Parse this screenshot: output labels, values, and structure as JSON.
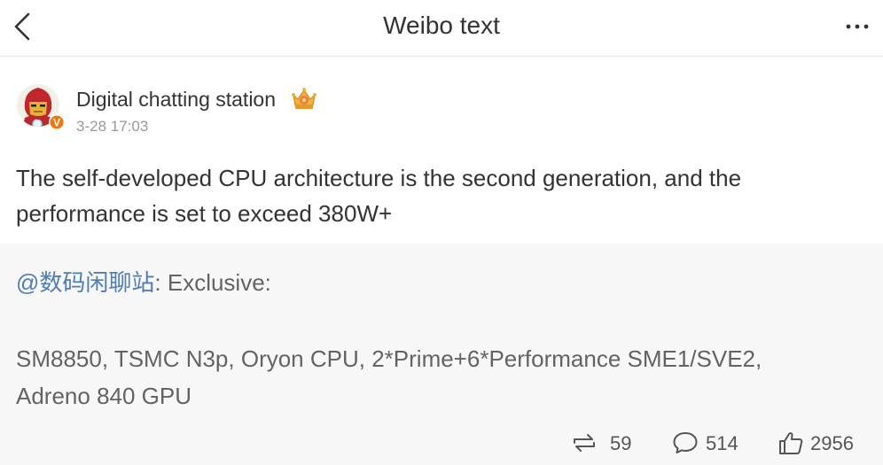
{
  "header": {
    "title": "Weibo text",
    "back_icon": "chevron-left-icon",
    "more_icon": "more-horizontal-icon"
  },
  "post": {
    "author": {
      "name": "Digital chatting station",
      "verified_badge": "V",
      "badge_icon": "crown-badge-icon"
    },
    "time": "3-28 17:03",
    "text_lines": [
      "The self-developed CPU architecture is the second generation, and the",
      "performance is set to exceed 380W+"
    ]
  },
  "repost": {
    "mention": "@数码闲聊站",
    "intro": ": Exclusive:",
    "spec_lines": [
      "SM8850, TSMC N3p, Oryon CPU, 2*Prime+6*Performance SME1/SVE2,",
      "Adreno 840 GPU"
    ]
  },
  "actions": {
    "reposts": "59",
    "comments": "514",
    "likes": "2956"
  },
  "colors": {
    "link": "#4f7db7",
    "verified": "#f0780a",
    "panel": "#f7f7f7"
  }
}
